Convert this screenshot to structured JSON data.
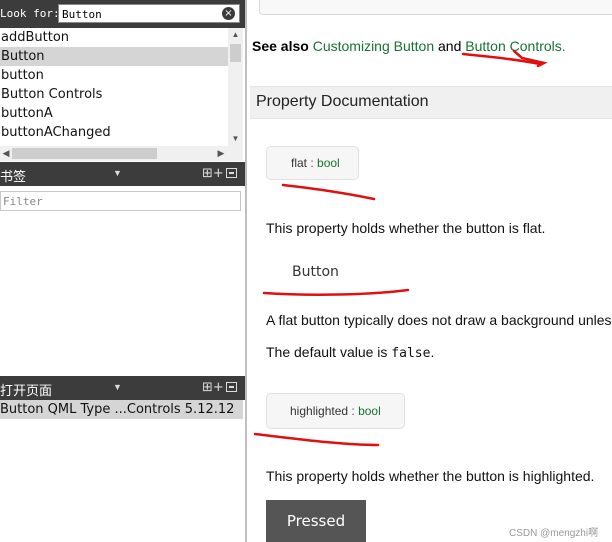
{
  "search": {
    "label": "Look for:",
    "value": "Button",
    "clear_icon": "×"
  },
  "index": {
    "items": [
      {
        "label": "addButton",
        "selected": false
      },
      {
        "label": "Button",
        "selected": true
      },
      {
        "label": "button",
        "selected": false
      },
      {
        "label": "Button Controls",
        "selected": false
      },
      {
        "label": "buttonA",
        "selected": false
      },
      {
        "label": "buttonAChanged",
        "selected": false
      }
    ]
  },
  "bookmarks": {
    "title": "书签",
    "filter_placeholder": "Filter",
    "dropdown_icon": "▼",
    "split_icon": "⊞+"
  },
  "open_pages": {
    "title": "打开页面",
    "dropdown_icon": "▼",
    "split_icon": "⊞+",
    "items": [
      "Button QML Type ...Controls 5.12.12"
    ]
  },
  "doc": {
    "see_also_label": "See also",
    "see_also_link1": "Customizing Button",
    "see_also_and": "and",
    "see_also_link2": "Button Controls",
    "see_also_end": ".",
    "section_title": "Property Documentation",
    "prop1": {
      "name": "flat",
      "sep": " : ",
      "type": "bool"
    },
    "prop1_desc": "This property holds whether the button is flat.",
    "prop1_sample": "Button",
    "prop1_more": "A flat button typically does not draw a background unless",
    "default_prefix": "The default value is ",
    "default_value": "false",
    "default_suffix": ".",
    "prop2": {
      "name": "highlighted",
      "sep": " : ",
      "type": "bool"
    },
    "prop2_desc": "This property holds whether the button is highlighted.",
    "pressed_label": "Pressed"
  },
  "watermark": "CSDN @mengzhi啊",
  "colors": {
    "panel_header": "#3c3c3c",
    "link": "#17732f",
    "annotation": "#e01010",
    "selection": "#d5d5d5"
  }
}
